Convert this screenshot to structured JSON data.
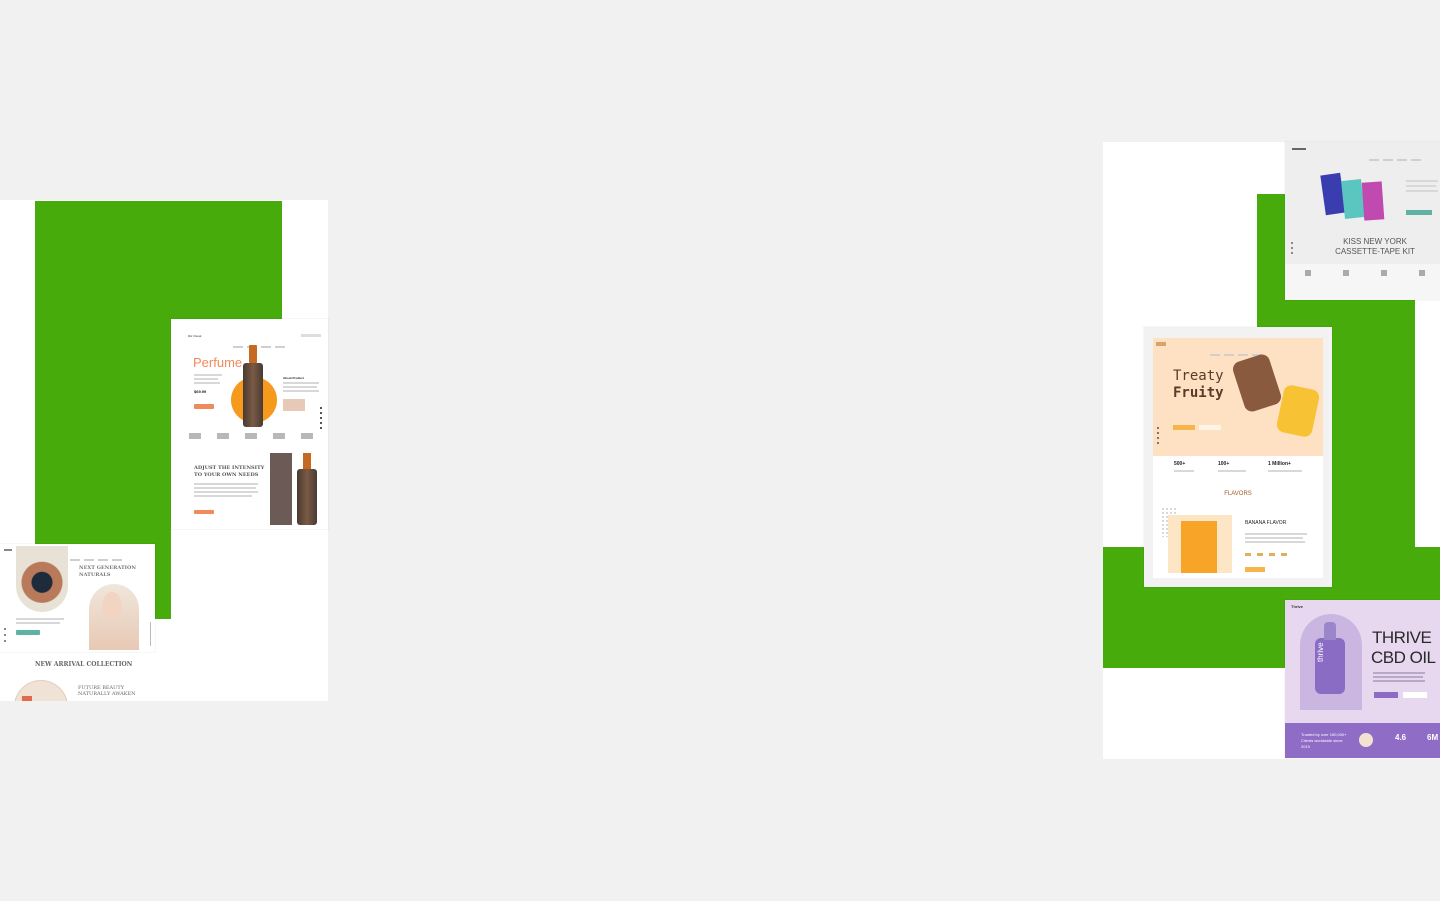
{
  "colors": {
    "background": "#f1f1f1",
    "accent_green": "#47ab0b",
    "panel": "#ffffff"
  },
  "perfume_site": {
    "logo": "DH Visual",
    "hero_title": "Perfume",
    "price": "$69.99",
    "about_title": "About Product",
    "section_title_1": "ADJUST THE INTENSITY",
    "section_title_2": "TO YOUR OWN NEEDS"
  },
  "naturals_site": {
    "hero_title_1": "NEXT GENERATION",
    "hero_title_2": "NATURALS",
    "collection_title": "NEW ARRIVAL COLLECTION",
    "feature_1": "FUTURE BEAUTY",
    "feature_2": "NATURALLY AWAKEN"
  },
  "cassette_site": {
    "title_1": "KISS NEW YORK",
    "title_2": "CASSETTE-TAPE KIT"
  },
  "treaty_site": {
    "hero_1": "Treaty",
    "hero_2": "Fruity",
    "stats": [
      {
        "value": "500+"
      },
      {
        "value": "100+"
      },
      {
        "value": "1 Million+"
      }
    ],
    "flavors_title": "FLAVORS",
    "flavor_name": "BANANA FLAVOR"
  },
  "thrive_site": {
    "logo": "Thrive",
    "title_1": "THRIVE",
    "title_2": "CBD OIL",
    "bottle_text": "thrive",
    "trusted": "Trusted by over 150,000+",
    "trusted_2": "Clients worldwide since",
    "trusted_3": "2019",
    "rating": "4.6",
    "count": "6M"
  }
}
